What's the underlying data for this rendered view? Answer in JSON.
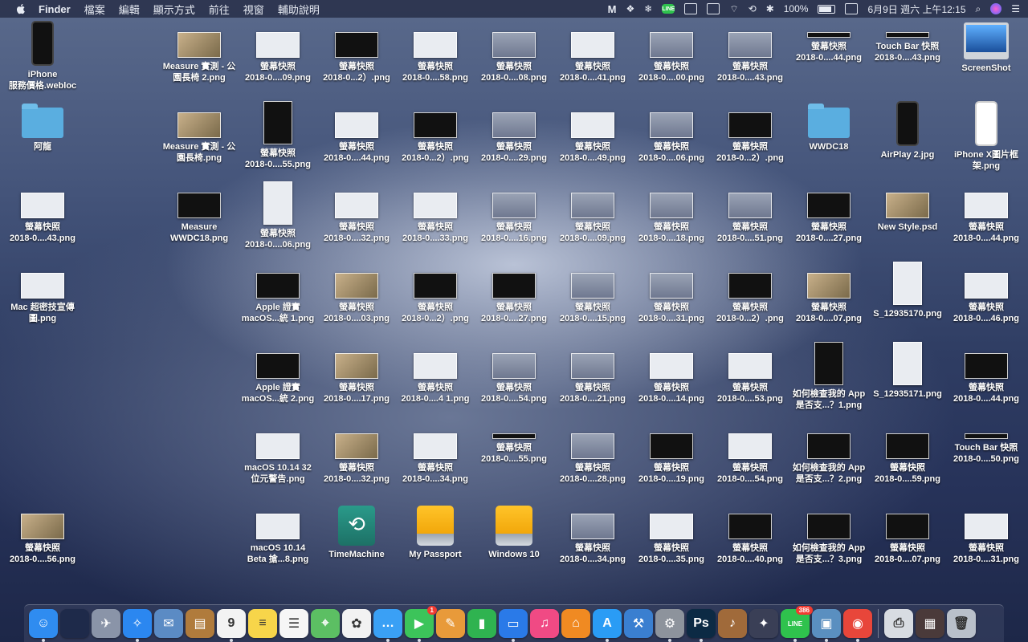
{
  "menubar": {
    "app_name": "Finder",
    "items": [
      "檔案",
      "編輯",
      "顯示方式",
      "前往",
      "視窗",
      "輔助說明"
    ],
    "battery": "100%",
    "date_time": "6月9日 週六 上午12:15",
    "line_label": "LINE"
  },
  "desktop": {
    "rows": [
      [
        {
          "label1": "iPhone",
          "label2": "服務價格.webloc",
          "kind": "phone"
        },
        {
          "label1": "",
          "label2": "",
          "kind": "empty"
        },
        {
          "label1": "Measure 實測 - 公",
          "label2": "園長椅 2.png",
          "kind": "photo"
        },
        {
          "label1": "螢幕快照",
          "label2": "2018-0....09.png",
          "kind": "light"
        },
        {
          "label1": "螢幕快照",
          "label2": "2018-0...2）.png",
          "kind": "dark"
        },
        {
          "label1": "螢幕快照",
          "label2": "2018-0....58.png",
          "kind": "light"
        },
        {
          "label1": "螢幕快照",
          "label2": "2018-0....08.png",
          "kind": "gray"
        },
        {
          "label1": "螢幕快照",
          "label2": "2018-0....41.png",
          "kind": "light"
        },
        {
          "label1": "螢幕快照",
          "label2": "2018-0....00.png",
          "kind": "gray"
        },
        {
          "label1": "螢幕快照",
          "label2": "2018-0....43.png",
          "kind": "gray"
        },
        {
          "label1": "螢幕快照",
          "label2": "2018-0....44.png",
          "kind": "tbar"
        },
        {
          "label1": "Touch Bar 快照",
          "label2": "2018-0....43.png",
          "kind": "tbar"
        },
        {
          "label1": "ScreenShot",
          "label2": "",
          "kind": "imac"
        }
      ],
      [
        {
          "label1": "阿龍",
          "label2": "",
          "kind": "folder"
        },
        {
          "label1": "",
          "label2": "",
          "kind": "empty"
        },
        {
          "label1": "Measure 實測 - 公",
          "label2": "園長椅.png",
          "kind": "photo"
        },
        {
          "label1": "螢幕快照",
          "label2": "2018-0....55.png",
          "kind": "darktall"
        },
        {
          "label1": "螢幕快照",
          "label2": "2018-0....44.png",
          "kind": "light"
        },
        {
          "label1": "螢幕快照",
          "label2": "2018-0...2）.png",
          "kind": "dark"
        },
        {
          "label1": "螢幕快照",
          "label2": "2018-0....29.png",
          "kind": "gray"
        },
        {
          "label1": "螢幕快照",
          "label2": "2018-0....49.png",
          "kind": "light"
        },
        {
          "label1": "螢幕快照",
          "label2": "2018-0....06.png",
          "kind": "gray"
        },
        {
          "label1": "螢幕快照",
          "label2": "2018-0...2）.png",
          "kind": "dark"
        },
        {
          "label1": "WWDC18",
          "label2": "",
          "kind": "folder"
        },
        {
          "label1": "AirPlay 2.jpg",
          "label2": "",
          "kind": "phone"
        },
        {
          "label1": "iPhone X圖片框",
          "label2": "架.png",
          "kind": "phonewhite"
        }
      ],
      [
        {
          "label1": "螢幕快照",
          "label2": "2018-0....43.png",
          "kind": "light"
        },
        {
          "label1": "",
          "label2": "",
          "kind": "empty"
        },
        {
          "label1": "Measure",
          "label2": "WWDC18.png",
          "kind": "dark"
        },
        {
          "label1": "螢幕快照",
          "label2": "2018-0....06.png",
          "kind": "lighttall"
        },
        {
          "label1": "螢幕快照",
          "label2": "2018-0....32.png",
          "kind": "light"
        },
        {
          "label1": "螢幕快照",
          "label2": "2018-0....33.png",
          "kind": "light"
        },
        {
          "label1": "螢幕快照",
          "label2": "2018-0....16.png",
          "kind": "gray"
        },
        {
          "label1": "螢幕快照",
          "label2": "2018-0....09.png",
          "kind": "gray"
        },
        {
          "label1": "螢幕快照",
          "label2": "2018-0....18.png",
          "kind": "gray"
        },
        {
          "label1": "螢幕快照",
          "label2": "2018-0....51.png",
          "kind": "gray"
        },
        {
          "label1": "螢幕快照",
          "label2": "2018-0....27.png",
          "kind": "dark"
        },
        {
          "label1": "New Style.psd",
          "label2": "",
          "kind": "photo"
        },
        {
          "label1": "螢幕快照",
          "label2": "2018-0....44.png",
          "kind": "light"
        }
      ],
      [
        {
          "label1": "Mac 超密技宣傳",
          "label2": "圖.png",
          "kind": "light"
        },
        {
          "label1": "",
          "label2": "",
          "kind": "empty"
        },
        {
          "label1": "",
          "label2": "",
          "kind": "empty"
        },
        {
          "label1": "Apple 證實",
          "label2": "macOS...統 1.png",
          "kind": "dark"
        },
        {
          "label1": "螢幕快照",
          "label2": "2018-0....03.png",
          "kind": "photo"
        },
        {
          "label1": "螢幕快照",
          "label2": "2018-0...2）.png",
          "kind": "dark"
        },
        {
          "label1": "螢幕快照",
          "label2": "2018-0....27.png",
          "kind": "dark"
        },
        {
          "label1": "螢幕快照",
          "label2": "2018-0....15.png",
          "kind": "gray"
        },
        {
          "label1": "螢幕快照",
          "label2": "2018-0....31.png",
          "kind": "gray"
        },
        {
          "label1": "螢幕快照",
          "label2": "2018-0...2）.png",
          "kind": "dark"
        },
        {
          "label1": "螢幕快照",
          "label2": "2018-0....07.png",
          "kind": "photo"
        },
        {
          "label1": "S_12935170.png",
          "label2": "",
          "kind": "lighttall"
        },
        {
          "label1": "螢幕快照",
          "label2": "2018-0....46.png",
          "kind": "light"
        }
      ],
      [
        {
          "label1": "",
          "label2": "",
          "kind": "empty"
        },
        {
          "label1": "",
          "label2": "",
          "kind": "empty"
        },
        {
          "label1": "",
          "label2": "",
          "kind": "empty"
        },
        {
          "label1": "Apple 證實",
          "label2": "macOS...統 2.png",
          "kind": "dark"
        },
        {
          "label1": "螢幕快照",
          "label2": "2018-0....17.png",
          "kind": "photo"
        },
        {
          "label1": "螢幕快照",
          "label2": "2018-0....4 1.png",
          "kind": "light"
        },
        {
          "label1": "螢幕快照",
          "label2": "2018-0....54.png",
          "kind": "gray"
        },
        {
          "label1": "螢幕快照",
          "label2": "2018-0....21.png",
          "kind": "gray"
        },
        {
          "label1": "螢幕快照",
          "label2": "2018-0....14.png",
          "kind": "light"
        },
        {
          "label1": "螢幕快照",
          "label2": "2018-0....53.png",
          "kind": "light"
        },
        {
          "label1": "如何檢查我的 App",
          "label2": "是否支...？1.png",
          "kind": "darktall"
        },
        {
          "label1": "S_12935171.png",
          "label2": "",
          "kind": "lighttall"
        },
        {
          "label1": "螢幕快照",
          "label2": "2018-0....44.png",
          "kind": "dark"
        }
      ],
      [
        {
          "label1": "",
          "label2": "",
          "kind": "empty"
        },
        {
          "label1": "",
          "label2": "",
          "kind": "empty"
        },
        {
          "label1": "",
          "label2": "",
          "kind": "empty"
        },
        {
          "label1": "macOS 10.14 32",
          "label2": "位元警告.png",
          "kind": "light"
        },
        {
          "label1": "螢幕快照",
          "label2": "2018-0....32.png",
          "kind": "photo"
        },
        {
          "label1": "螢幕快照",
          "label2": "2018-0....34.png",
          "kind": "light"
        },
        {
          "label1": "螢幕快照",
          "label2": "2018-0....55.png",
          "kind": "tbar"
        },
        {
          "label1": "螢幕快照",
          "label2": "2018-0....28.png",
          "kind": "gray"
        },
        {
          "label1": "螢幕快照",
          "label2": "2018-0....19.png",
          "kind": "dark"
        },
        {
          "label1": "螢幕快照",
          "label2": "2018-0....54.png",
          "kind": "light"
        },
        {
          "label1": "如何檢查我的 App",
          "label2": "是否支...？2.png",
          "kind": "dark"
        },
        {
          "label1": "螢幕快照",
          "label2": "2018-0....59.png",
          "kind": "dark"
        },
        {
          "label1": "Touch Bar 快照",
          "label2": "2018-0....50.png",
          "kind": "tbar"
        }
      ],
      [
        {
          "label1": "螢幕快照",
          "label2": "2018-0....56.png",
          "kind": "photo"
        },
        {
          "label1": "",
          "label2": "",
          "kind": "empty"
        },
        {
          "label1": "",
          "label2": "",
          "kind": "empty"
        },
        {
          "label1": "macOS 10.14",
          "label2": "Beta 搶...8.png",
          "kind": "light"
        },
        {
          "label1": "TimeMachine",
          "label2": "",
          "kind": "timemachine"
        },
        {
          "label1": "My Passport",
          "label2": "",
          "kind": "drive"
        },
        {
          "label1": "Windows 10",
          "label2": "",
          "kind": "drive"
        },
        {
          "label1": "螢幕快照",
          "label2": "2018-0....34.png",
          "kind": "gray"
        },
        {
          "label1": "螢幕快照",
          "label2": "2018-0....35.png",
          "kind": "light"
        },
        {
          "label1": "螢幕快照",
          "label2": "2018-0....40.png",
          "kind": "dark"
        },
        {
          "label1": "如何檢查我的 App",
          "label2": "是否支...？3.png",
          "kind": "dark"
        },
        {
          "label1": "螢幕快照",
          "label2": "2018-0....07.png",
          "kind": "dark"
        },
        {
          "label1": "螢幕快照",
          "label2": "2018-0....31.png",
          "kind": "light"
        }
      ]
    ]
  },
  "dock": {
    "apps": [
      {
        "name": "finder-icon",
        "glyph": "☺",
        "color": "#2f8cf0",
        "running": true
      },
      {
        "name": "blank-app-icon",
        "glyph": "",
        "color": "#1e2a4a",
        "running": false
      },
      {
        "name": "launchpad-icon",
        "glyph": "✈",
        "color": "#8a94a8",
        "running": false
      },
      {
        "name": "safari-icon",
        "glyph": "✧",
        "color": "#2b87f0",
        "running": true
      },
      {
        "name": "mail-bird-icon",
        "glyph": "✉",
        "color": "#5b8bc4",
        "running": false
      },
      {
        "name": "notebook-icon",
        "glyph": "▤",
        "color": "#b07b3c",
        "running": false
      },
      {
        "name": "calendar-icon",
        "glyph": "9",
        "color": "#f3f3f3",
        "running": true
      },
      {
        "name": "notes-icon",
        "glyph": "≡",
        "color": "#f7d54a",
        "running": false
      },
      {
        "name": "reminders-icon",
        "glyph": "☰",
        "color": "#f6f6f6",
        "running": false
      },
      {
        "name": "maps-icon",
        "glyph": "⌖",
        "color": "#5cbf63",
        "running": false
      },
      {
        "name": "photos-icon",
        "glyph": "✿",
        "color": "#f2f2f2",
        "running": false
      },
      {
        "name": "messages-icon",
        "glyph": "…",
        "color": "#3aa0f5",
        "running": true
      },
      {
        "name": "facetime-icon",
        "glyph": "▶",
        "color": "#3cc45a",
        "running": true,
        "badge": "1"
      },
      {
        "name": "keynote-pen-icon",
        "glyph": "✎",
        "color": "#e89a3a",
        "running": false
      },
      {
        "name": "numbers-icon",
        "glyph": "▮",
        "color": "#2fb350",
        "running": false
      },
      {
        "name": "keynote-icon",
        "glyph": "▭",
        "color": "#2a7ae8",
        "running": true
      },
      {
        "name": "itunes-icon",
        "glyph": "♫",
        "color": "#f04a84",
        "running": false
      },
      {
        "name": "ibooks-icon",
        "glyph": "⌂",
        "color": "#f08a22",
        "running": false
      },
      {
        "name": "app-store-icon",
        "glyph": "A",
        "color": "#2a9cf5",
        "running": true
      },
      {
        "name": "xcode-icon",
        "glyph": "⚒",
        "color": "#3a7fd0",
        "running": false
      },
      {
        "name": "system-preferences-icon",
        "glyph": "⚙",
        "color": "#8d939c",
        "running": true
      },
      {
        "name": "photoshop-icon",
        "glyph": "Ps",
        "color": "#0c2a44",
        "running": true
      },
      {
        "name": "garageband-icon",
        "glyph": "♪",
        "color": "#a06a3a",
        "running": false
      },
      {
        "name": "final-cut-icon",
        "glyph": "✦",
        "color": "#3a3f56",
        "running": false
      },
      {
        "name": "line-icon",
        "glyph": "LINE",
        "color": "#2fc24d",
        "running": true,
        "badge": "386"
      },
      {
        "name": "preview-icon",
        "glyph": "▣",
        "color": "#5a8fc0",
        "running": true
      },
      {
        "name": "chrome-icon",
        "glyph": "◉",
        "color": "#e8463a",
        "running": true
      }
    ],
    "right_items": [
      {
        "name": "printer-icon",
        "glyph": "⎙",
        "color": "#d8dce2"
      },
      {
        "name": "downloads-stack-icon",
        "glyph": "▦",
        "color": "#4a3a3a"
      },
      {
        "name": "trash-icon",
        "glyph": "🗑",
        "color": "#b9c0ca"
      }
    ]
  }
}
